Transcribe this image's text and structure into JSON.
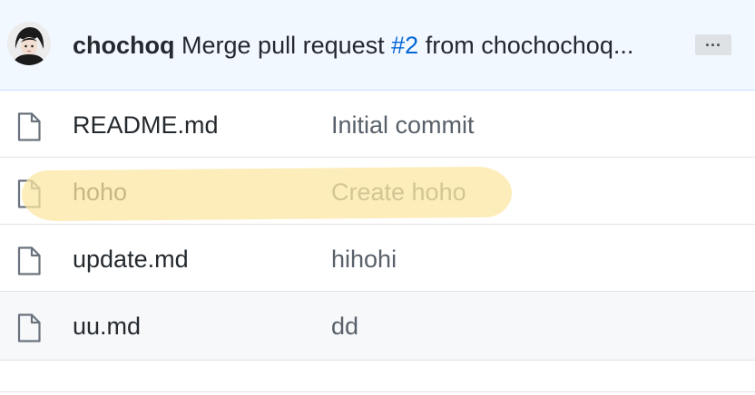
{
  "latest_commit": {
    "author": "chochoq",
    "message_prefix": "Merge pull request",
    "pr_link": "#2",
    "message_suffix": "from chochochoq...",
    "more_button": "..."
  },
  "files": [
    {
      "icon": "file-icon",
      "name": "README.md",
      "message": "Initial commit"
    },
    {
      "icon": "file-icon",
      "name": "hoho",
      "message": "Create hoho"
    },
    {
      "icon": "file-icon",
      "name": "update.md",
      "message": "hihohi"
    },
    {
      "icon": "file-icon",
      "name": "uu.md",
      "message": "dd"
    }
  ],
  "colors": {
    "header_bg": "#f1f8ff",
    "link": "#0366d6",
    "highlight": "#fce7a3"
  }
}
